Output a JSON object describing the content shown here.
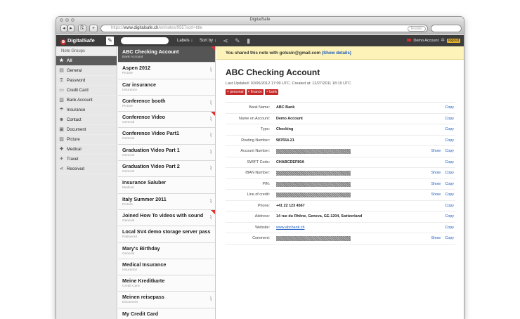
{
  "window_title": "DigitalSafe",
  "browser": {
    "url_scheme": "https://",
    "url_host": "www.digitalsafe.ch",
    "url_path": "/en/notes/9557sort=title",
    "reader_label": "Reader"
  },
  "app": {
    "logo": "DigitalSafe",
    "search_placeholder": "",
    "labels_link": "Labels ↓",
    "sort_link": "Sort by ↓",
    "account_label": "Demo Account",
    "logout_label": "logout"
  },
  "nav": {
    "header": "Note Groups",
    "items": [
      {
        "label": "All",
        "icon": "★"
      },
      {
        "label": "General",
        "icon": "▤"
      },
      {
        "label": "Password",
        "icon": "⚿"
      },
      {
        "label": "Credit Card",
        "icon": "▭"
      },
      {
        "label": "Bank Account",
        "icon": "▥"
      },
      {
        "label": "Insurance",
        "icon": "☂"
      },
      {
        "label": "Contact",
        "icon": "☻"
      },
      {
        "label": "Document",
        "icon": "▣"
      },
      {
        "label": "Picture",
        "icon": "▨"
      },
      {
        "label": "Medical",
        "icon": "✚"
      },
      {
        "label": "Travel",
        "icon": "✈"
      },
      {
        "label": "Received",
        "icon": "⋖"
      }
    ]
  },
  "notes": [
    {
      "title": "ABC Checking Account",
      "sub": "Bank Account",
      "clip": false,
      "flag": true
    },
    {
      "title": "Aspen 2012",
      "sub": "Picture",
      "clip": true,
      "flag": false
    },
    {
      "title": "Car insurance",
      "sub": "Insurance",
      "clip": false,
      "flag": false
    },
    {
      "title": "Conference booth",
      "sub": "Picture",
      "clip": true,
      "flag": false
    },
    {
      "title": "Conference Video",
      "sub": "General",
      "clip": true,
      "flag": true
    },
    {
      "title": "Conference Video Part1",
      "sub": "General",
      "clip": true,
      "flag": false
    },
    {
      "title": "Graduation Video Part 1",
      "sub": "General",
      "clip": true,
      "flag": false
    },
    {
      "title": "Graduation Video Part 2",
      "sub": "General",
      "clip": true,
      "flag": false
    },
    {
      "title": "Insurance Saluber",
      "sub": "Medical",
      "clip": false,
      "flag": false
    },
    {
      "title": "Italy Summer 2011",
      "sub": "Picture",
      "clip": true,
      "flag": false
    },
    {
      "title": "Joined How To videos with sound",
      "sub": "General",
      "clip": true,
      "flag": true
    },
    {
      "title": "Local SV4 demo storage server pass",
      "sub": "Password",
      "clip": false,
      "flag": false
    },
    {
      "title": "Mary's Birthday",
      "sub": "General",
      "clip": false,
      "flag": false
    },
    {
      "title": "Medical Insurance",
      "sub": "Insurance",
      "clip": false,
      "flag": false
    },
    {
      "title": "Meine Kreditkarte",
      "sub": "Credit Card",
      "clip": false,
      "flag": false
    },
    {
      "title": "Meinen reisepass",
      "sub": "Document",
      "clip": true,
      "flag": false
    },
    {
      "title": "My Credit Card",
      "sub": "",
      "clip": false,
      "flag": false
    }
  ],
  "detail": {
    "share_text": "You shared this note with golusin@gmail.com",
    "share_link": "(Show details)",
    "title": "ABC Checking Account",
    "meta": "Last Updated: 02/06/2012 17:09 UTC. Created at: 12/27/2011 18:19 UTC",
    "tags": [
      "personal",
      "finance",
      "bank"
    ],
    "show_label": "Show",
    "copy_label": "Copy",
    "fields": [
      {
        "label": "Bank Name:",
        "value": "ABC Bank",
        "masked": false,
        "show": false,
        "copy": true,
        "link": false
      },
      {
        "label": "Name on Account:",
        "value": "Demo Account",
        "masked": false,
        "show": false,
        "copy": true,
        "link": false
      },
      {
        "label": "Type:",
        "value": "Checking",
        "masked": false,
        "show": false,
        "copy": true,
        "link": false
      },
      {
        "label": "Routing Number:",
        "value": "987654-21",
        "masked": false,
        "show": false,
        "copy": true,
        "link": false
      },
      {
        "label": "Account Number:",
        "value": "",
        "masked": true,
        "show": true,
        "copy": true,
        "link": false
      },
      {
        "label": "SWIFT Code:",
        "value": "CHABCDEF80A",
        "masked": false,
        "show": false,
        "copy": true,
        "link": false
      },
      {
        "label": "IBAN Number:",
        "value": "",
        "masked": true,
        "show": true,
        "copy": true,
        "link": false
      },
      {
        "label": "PIN:",
        "value": "",
        "masked": true,
        "show": true,
        "copy": true,
        "link": false
      },
      {
        "label": "Line of credit:",
        "value": "",
        "masked": true,
        "show": true,
        "copy": true,
        "link": false
      },
      {
        "label": "Phone:",
        "value": "+41 22 123 4567",
        "masked": false,
        "show": false,
        "copy": true,
        "link": false
      },
      {
        "label": "Address:",
        "value": "14 rue du Rhône, Geneva, GE-1204, Switzerland",
        "masked": false,
        "show": false,
        "copy": true,
        "link": false
      },
      {
        "label": "Website:",
        "value": "www.abcbank.ch",
        "masked": false,
        "show": false,
        "copy": true,
        "link": true
      },
      {
        "label": "Comment:",
        "value": "",
        "masked": true,
        "show": true,
        "copy": true,
        "link": false
      }
    ]
  }
}
